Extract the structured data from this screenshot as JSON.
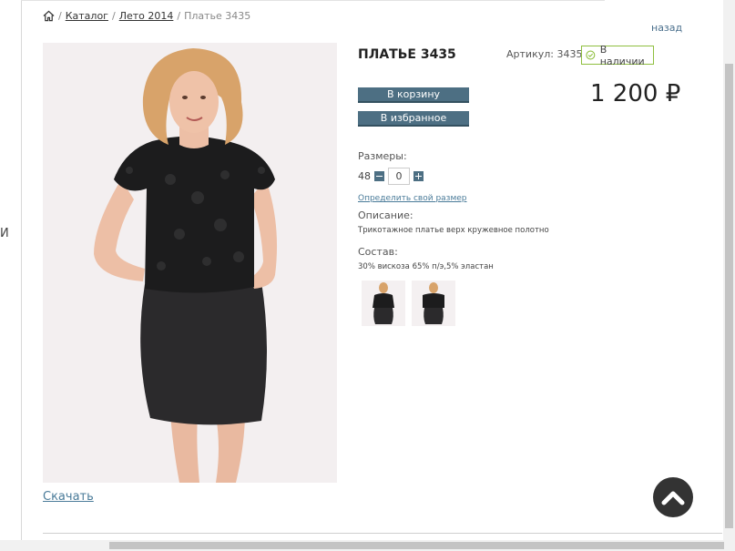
{
  "left_edge_letter": "И",
  "breadcrumb": {
    "home_icon": "home-icon",
    "items": [
      "Каталог",
      "Лето 2014"
    ],
    "current": "Платье 3435",
    "separator": "/"
  },
  "back_link": "назад",
  "product": {
    "title": "ПЛАТЬЕ 3435",
    "article": "Артикул: 3435",
    "stock": "В наличии",
    "stock_icon": "check-circle-icon",
    "price": "1 200 ₽",
    "cart_button": "В корзину",
    "favorite_button": "В избранное",
    "sizes_label": "Размеры:",
    "size": "48",
    "quantity": "0",
    "size_help": "Определить свой размер",
    "description_label": "Описание:",
    "description": "Трикотажное платье верх кружевное полотно",
    "composition_label": "Состав:",
    "composition": "30% вискоза 65% п/э,5% эластан",
    "download": "Скачать"
  },
  "colors": {
    "button": "#4d6f83",
    "stock_border": "#8fbf3f",
    "link": "#4a7b99"
  },
  "scroll_top_icon": "chevron-up-icon"
}
